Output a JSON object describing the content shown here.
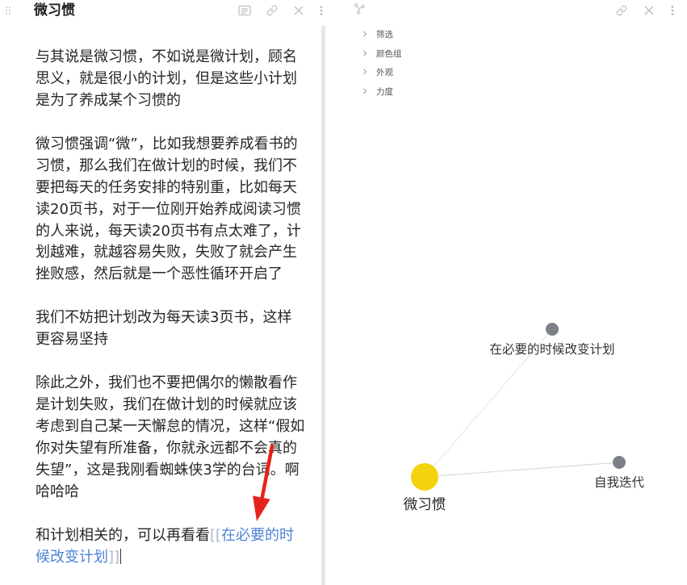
{
  "left_pane": {
    "header": {
      "title": "微习惯",
      "icons": {
        "drag": "drag-handle-icon",
        "mode": "reading-view-icon",
        "link": "link-icon",
        "close": "close-icon",
        "more": "more-options-icon"
      }
    },
    "editor": {
      "paragraphs": [
        [
          "与其说是微习惯，不如说是微计划，顾名",
          "思义，就是很小的计划，但是这些小计划",
          "是为了养成某个习惯的"
        ],
        [
          "微习惯强调“微”，比如我想要养成看书的",
          "习惯，那么我们在做计划的时候，我们不",
          "要把每天的任务安排的特别重，比如每天",
          "读20页书，对于一位刚开始养成阅读习惯",
          "的人来说，每天读20页书有点太难了，计",
          "划越难，就越容易失败，失败了就会产生",
          "挫败感，然后就是一个恶性循环开启了"
        ],
        [
          "我们不妨把计划改为每天读3页书，这样",
          "更容易坚持"
        ],
        [
          "除此之外，我们也不要把偶尔的懒散看作",
          "是计划失败，我们在做计划的时候就应该",
          "考虑到自己某一天懈怠的情况，这样“假如",
          "你对失望有所准备，你就永远都不会真的",
          "失望”，这是我刚看蜘蛛侠3学的台词。啊",
          "哈哈哈"
        ]
      ],
      "link_paragraph": {
        "lead_text": "和计划相关的，可以再看看",
        "open_bracket": "[[",
        "link_line1": "在必要的时",
        "link_line2": "候改变计划",
        "close_bracket": "]]"
      }
    }
  },
  "right_pane": {
    "header": {
      "icons": {
        "view": "graph-view-icon",
        "link": "link-icon",
        "close": "close-icon",
        "more": "more-options-icon"
      }
    },
    "graph_settings": [
      {
        "label": "筛选"
      },
      {
        "label": "颜色组"
      },
      {
        "label": "外观"
      },
      {
        "label": "力度"
      }
    ],
    "graph": {
      "nodes": [
        {
          "label": "微习惯",
          "active": true
        },
        {
          "label": "在必要的时候改变计划",
          "active": false
        },
        {
          "label": "自我迭代",
          "active": false
        }
      ],
      "edges": [
        {
          "from": 0,
          "to": 1
        },
        {
          "from": 0,
          "to": 2
        }
      ]
    }
  },
  "colors": {
    "text": "#262626",
    "link": "#4e82d6",
    "bracket": "#a8b6cc",
    "active_node": "#f4d20e",
    "node": "#7c8089",
    "annotation_arrow": "#e5231c"
  }
}
